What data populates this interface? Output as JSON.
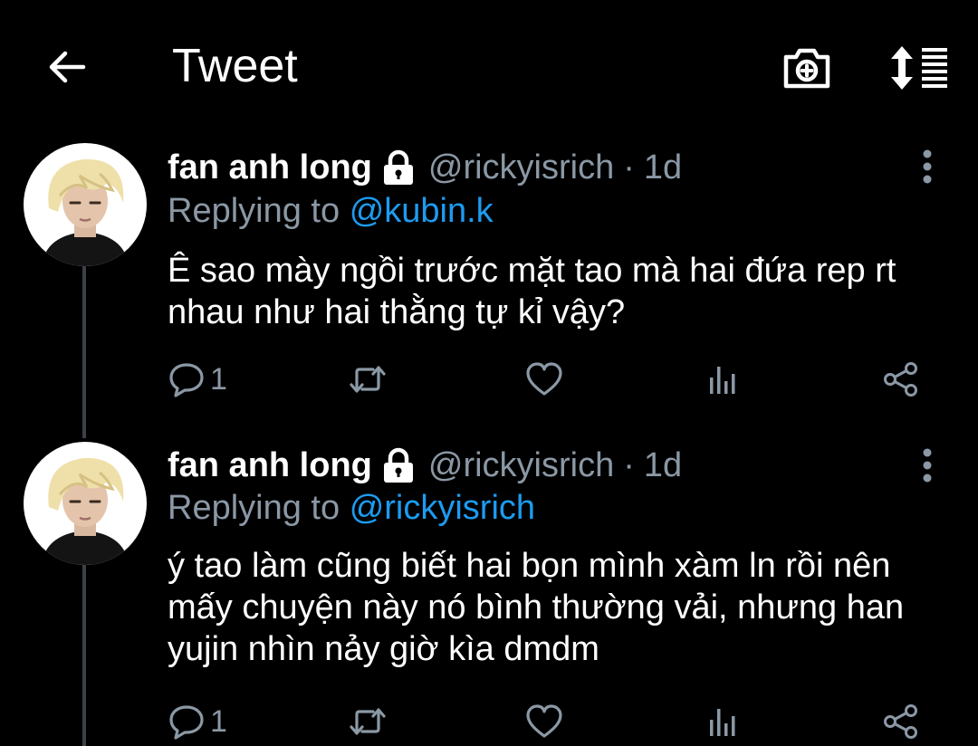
{
  "header": {
    "title": "Tweet",
    "back_icon": "arrow-left-icon",
    "camera_icon": "camera-plus-icon",
    "sort_icon": "sort-list-icon"
  },
  "colors": {
    "background": "#000000",
    "text_primary": "#ffffff",
    "text_secondary": "#8b98a5",
    "link": "#1d9bf0",
    "thread_line": "#3d4145"
  },
  "tweets": [
    {
      "display_name": "fan anh long",
      "locked": true,
      "handle": "@rickyisrich",
      "separator": "·",
      "time": "1d",
      "replying_prefix": "Replying to",
      "replying_to": "@kubin.k",
      "text": "Ê sao mày ngồi trước mặt tao mà hai đứa rep rt\nnhau như hai thằng tự kỉ vậy?",
      "reply_count": "1",
      "retweet_count": "",
      "like_count": ""
    },
    {
      "display_name": "fan anh long",
      "locked": true,
      "handle": "@rickyisrich",
      "separator": "·",
      "time": "1d",
      "replying_prefix": "Replying to",
      "replying_to": "@rickyisrich",
      "text": "ý tao làm cũng biết hai bọn mình xàm ln rồi nên\nmấy chuyện này nó bình thường vải, nhưng han\nyujin nhìn nảy giờ kìa dmdm",
      "reply_count": "1",
      "retweet_count": "",
      "like_count": ""
    }
  ]
}
